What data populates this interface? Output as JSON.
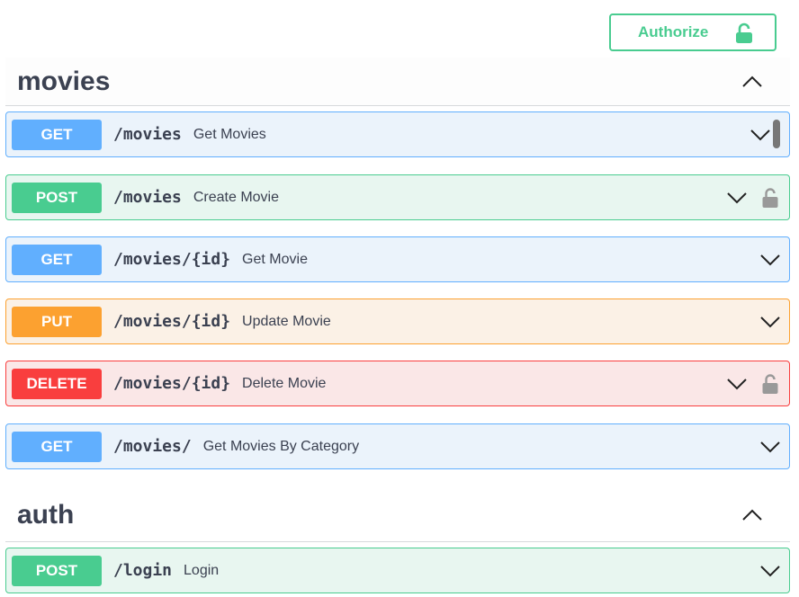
{
  "authorize": {
    "label": "Authorize"
  },
  "sections": [
    {
      "title": "movies"
    },
    {
      "title": "auth"
    }
  ],
  "operations": [
    {
      "method": "GET",
      "path": "/movies",
      "summary": "Get Movies"
    },
    {
      "method": "POST",
      "path": "/movies",
      "summary": "Create Movie"
    },
    {
      "method": "GET",
      "path": "/movies/{id}",
      "summary": "Get Movie"
    },
    {
      "method": "PUT",
      "path": "/movies/{id}",
      "summary": "Update Movie"
    },
    {
      "method": "DELETE",
      "path": "/movies/{id}",
      "summary": "Delete Movie"
    },
    {
      "method": "GET",
      "path": "/movies/",
      "summary": "Get Movies By Category"
    },
    {
      "method": "POST",
      "path": "/login",
      "summary": "Login"
    }
  ],
  "colors": {
    "get": "#61affe",
    "post": "#49cc90",
    "put": "#fca130",
    "delete": "#f93e3e",
    "text": "#3b4151"
  },
  "icons": {
    "authorize": "unlocked-lock-icon",
    "operation_lock": "lock-icon",
    "expand": "chevron-down-icon",
    "collapse": "chevron-up-icon"
  }
}
